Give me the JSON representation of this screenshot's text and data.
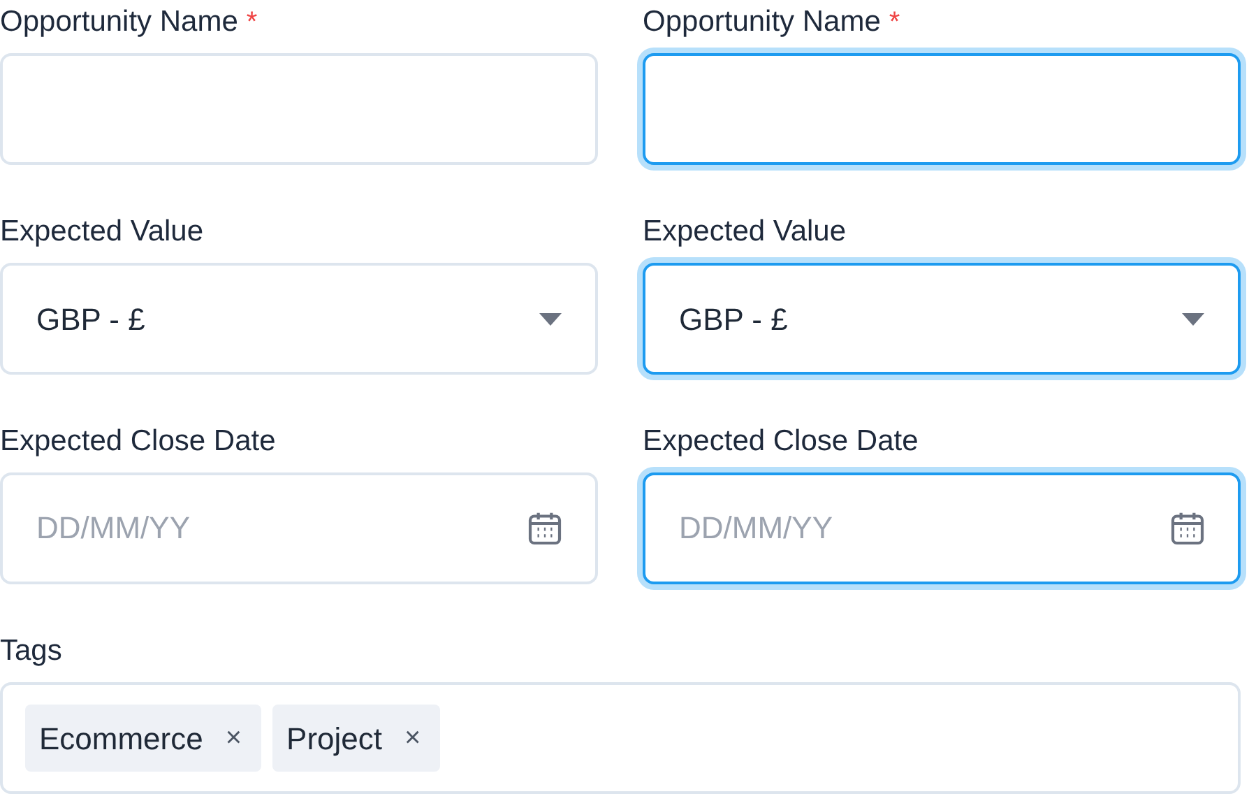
{
  "form_rows": [
    {
      "fields": [
        {
          "label": "Opportunity Name",
          "required": true,
          "kind": "text",
          "focused": false
        },
        {
          "label": "Opportunity Name",
          "required": true,
          "kind": "text",
          "focused": true
        }
      ]
    },
    {
      "fields": [
        {
          "label": "Expected Value",
          "required": false,
          "kind": "select",
          "focused": false,
          "value": "GBP - £"
        },
        {
          "label": "Expected Value",
          "required": false,
          "kind": "select",
          "focused": true,
          "value": "GBP - £"
        }
      ]
    },
    {
      "fields": [
        {
          "label": "Expected Close Date",
          "required": false,
          "kind": "date",
          "focused": false,
          "placeholder": "DD/MM/YY"
        },
        {
          "label": "Expected Close Date",
          "required": false,
          "kind": "date",
          "focused": true,
          "placeholder": "DD/MM/YY"
        }
      ]
    }
  ],
  "tags": {
    "label": "Tags",
    "items": [
      {
        "label": "Ecommerce",
        "remove": "×"
      },
      {
        "label": "Project",
        "remove": "×"
      }
    ]
  },
  "required_mark": "*"
}
